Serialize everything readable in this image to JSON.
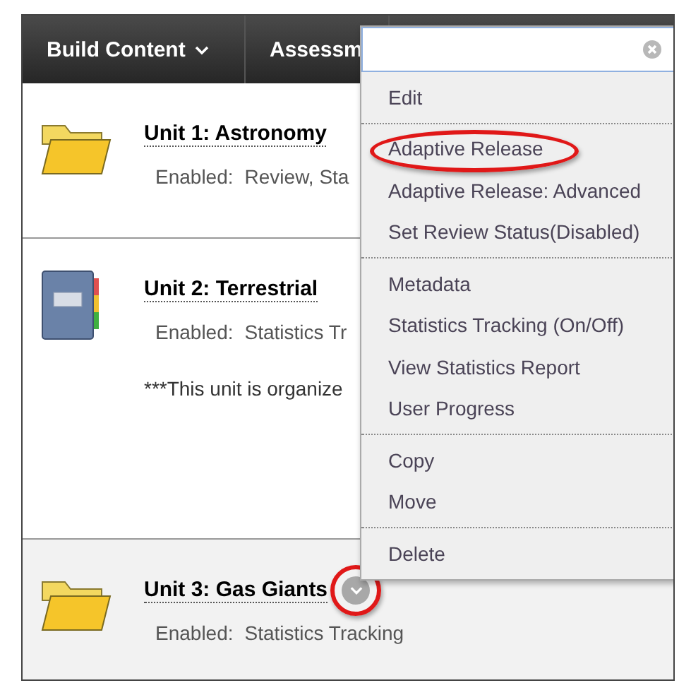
{
  "toolbar": {
    "tabs": [
      {
        "label": "Build Content",
        "kind": "dropdown"
      },
      {
        "label": "Assessm",
        "kind": "plain"
      }
    ]
  },
  "units": [
    {
      "title": "Unit 1: Astronomy",
      "kind": "folder",
      "enabled_label": "Enabled:",
      "enabled_value": "Review, Sta",
      "selected": false
    },
    {
      "title": "Unit 2: Terrestrial",
      "kind": "notebook",
      "enabled_label": "Enabled:",
      "enabled_value": "Statistics Tr",
      "note": "***This unit is organize",
      "selected": false
    },
    {
      "title": "Unit 3: Gas Giants",
      "kind": "folder",
      "enabled_label": "Enabled:",
      "enabled_value": "Statistics Tracking",
      "selected": true,
      "menu_button": {
        "circled": true
      }
    }
  ],
  "context_menu": {
    "groups": [
      [
        {
          "label": "Edit",
          "circled": false
        }
      ],
      [
        {
          "label": "Adaptive Release",
          "circled": true
        },
        {
          "label": "Adaptive Release: Advanced",
          "circled": false
        },
        {
          "label": "Set Review Status(Disabled)",
          "circled": false
        }
      ],
      [
        {
          "label": "Metadata",
          "circled": false
        },
        {
          "label": "Statistics Tracking (On/Off)",
          "circled": false
        },
        {
          "label": "View Statistics Report",
          "circled": false
        },
        {
          "label": "User Progress",
          "circled": false
        }
      ],
      [
        {
          "label": "Copy",
          "circled": false
        },
        {
          "label": "Move",
          "circled": false
        }
      ],
      [
        {
          "label": "Delete",
          "circled": false
        }
      ]
    ]
  }
}
